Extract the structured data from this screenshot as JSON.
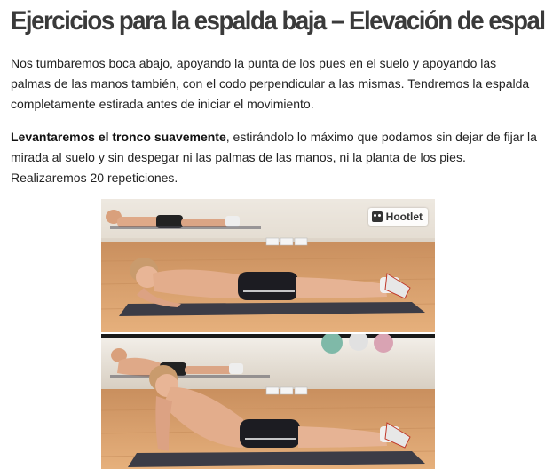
{
  "article": {
    "title": "Ejercicios para la espalda baja – Elevación de espalda",
    "paragraph1": "Nos tumbaremos boca  abajo, apoyando la punta de los pues en el suelo y apoyando las palmas de las manos también, con el codo perpendicular a las mismas. Tendremos la espalda completamente estirada antes de iniciar el movimiento.",
    "paragraph2_bold": "Levantaremos el tronco suavemente",
    "paragraph2_rest": ", estirándolo lo máximo que podamos sin dejar de fijar la mirada al suelo y sin despegar ni las palmas de las manos, ni la planta de los pies. Realizaremos 20 repeticiones."
  },
  "images": {
    "hootlet_label": "Hootlet",
    "hootlet_icon": "owl-icon"
  },
  "colors": {
    "title": "#3a3a3a",
    "text": "#222222",
    "floor": "#d9a271",
    "wall": "#ece6dc",
    "mat": "#3c3c46",
    "skin": "#e8b596",
    "shorts": "#1c1c22"
  }
}
